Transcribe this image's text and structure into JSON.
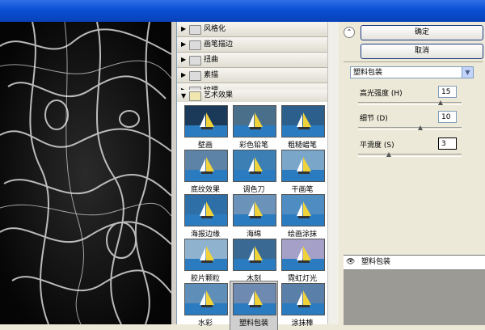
{
  "categories": [
    {
      "label": "风格化",
      "expanded": false
    },
    {
      "label": "画笔描边",
      "expanded": false
    },
    {
      "label": "扭曲",
      "expanded": false
    },
    {
      "label": "素描",
      "expanded": false
    },
    {
      "label": "纹理",
      "expanded": false
    },
    {
      "label": "艺术效果",
      "expanded": true
    }
  ],
  "filters": [
    {
      "label": "壁画"
    },
    {
      "label": "彩色铅笔"
    },
    {
      "label": "粗糙蜡笔"
    },
    {
      "label": "底纹效果"
    },
    {
      "label": "调色刀"
    },
    {
      "label": "干画笔"
    },
    {
      "label": "海报边缘"
    },
    {
      "label": "海绵"
    },
    {
      "label": "绘画涂抹"
    },
    {
      "label": "胶片颗粒"
    },
    {
      "label": "木刻"
    },
    {
      "label": "霓虹灯光"
    },
    {
      "label": "水彩"
    },
    {
      "label": "塑料包装",
      "selected": true
    },
    {
      "label": "涂抹棒"
    }
  ],
  "buttons": {
    "ok": "确定",
    "cancel": "取消"
  },
  "filter_select": {
    "value": "塑料包装"
  },
  "params": [
    {
      "label": "高光强度 (H)",
      "value": "15",
      "level": 0.8
    },
    {
      "label": "细节 (D)",
      "value": "10",
      "level": 0.6
    },
    {
      "label": "平滑度 (S)",
      "value": "3",
      "level": 0.3
    }
  ],
  "layer": {
    "label": "塑料包装"
  },
  "colors": {
    "title": "#0a4fd4",
    "selected": "#cfcfcf"
  }
}
